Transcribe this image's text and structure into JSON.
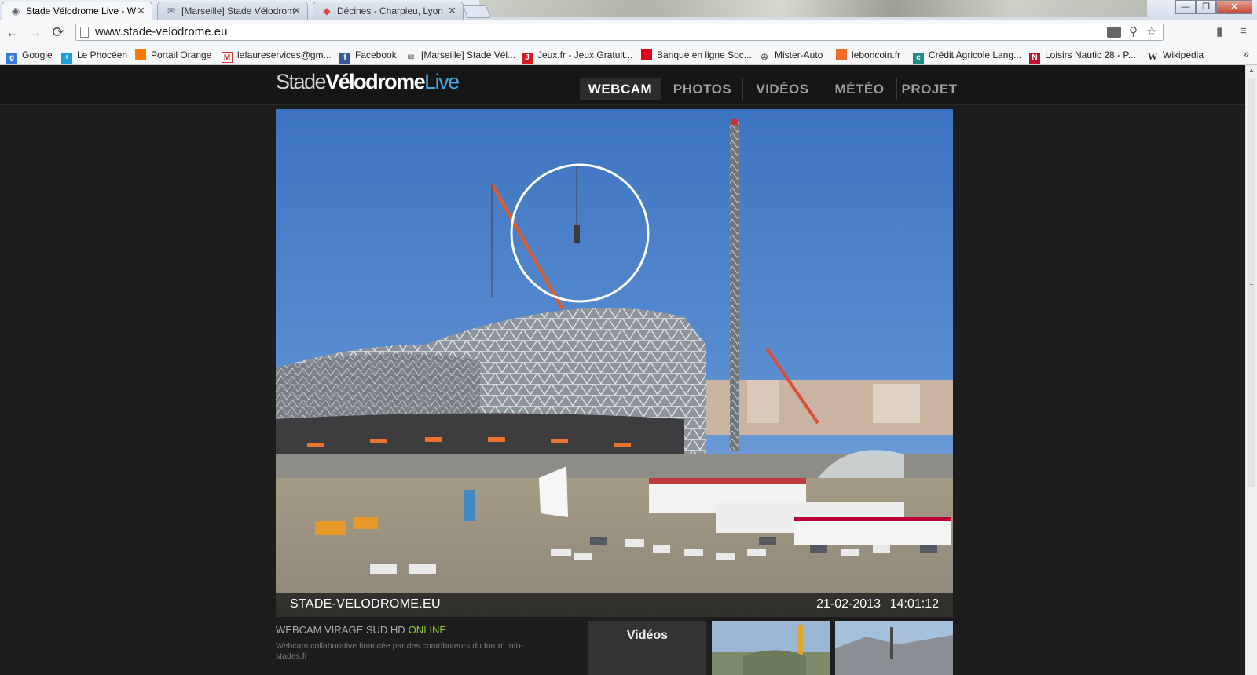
{
  "tabs": [
    {
      "title": "Stade Vélodrome Live - W",
      "icon": "webcam-icon",
      "active": true
    },
    {
      "title": "[Marseille] Stade Vélodrom",
      "icon": "forum-icon",
      "active": false
    },
    {
      "title": "Décines - Charpieu, Lyon",
      "icon": "maps-icon",
      "active": false
    }
  ],
  "toolbar": {
    "back": "←",
    "forward": "→",
    "reload": "⟳",
    "url": "www.stade-velodrome.eu"
  },
  "bookmarks": [
    {
      "label": "Google",
      "icon": "google-icon",
      "color": "#3b7be0"
    },
    {
      "label": "Le Phocéen",
      "icon": "phoceen-icon",
      "color": "#1d9fd8"
    },
    {
      "label": "Portail Orange",
      "icon": "orange-icon",
      "color": "#ff7900"
    },
    {
      "label": "lefaureservices@gm...",
      "icon": "gmail-icon",
      "color": "#d93025"
    },
    {
      "label": "Facebook",
      "icon": "facebook-icon",
      "color": "#3b5998"
    },
    {
      "label": "[Marseille] Stade Vél...",
      "icon": "forum-icon",
      "color": "#9aa"
    },
    {
      "label": "Jeux.fr - Jeux Gratuit...",
      "icon": "jeux-icon",
      "color": "#d71920"
    },
    {
      "label": "Banque en ligne Soc...",
      "icon": "bank-icon",
      "color": "#e2001a"
    },
    {
      "label": "Mister-Auto",
      "icon": "car-icon",
      "color": "#555"
    },
    {
      "label": "leboncoin.fr",
      "icon": "leboncoin-icon",
      "color": "#f56b2a"
    },
    {
      "label": "Crédit Agricole Lang...",
      "icon": "credit-agricole-icon",
      "color": "#1a8c83"
    },
    {
      "label": "Loisirs Nautic 28 - P...",
      "icon": "nautic-icon",
      "color": "#c8102e"
    },
    {
      "label": "Wikipedia",
      "icon": "wikipedia-icon",
      "color": "#333"
    }
  ],
  "site": {
    "logo_part1": "Stade",
    "logo_part2": "Vélodrome",
    "logo_part3": "Live",
    "nav": [
      "WEBCAM",
      "PHOTOS",
      "VIDÉOS",
      "MÉTÉO",
      "PROJET"
    ],
    "nav_active": "WEBCAM"
  },
  "webcam": {
    "brand": "STADE-VELODROME.EU",
    "date": "21-02-2013",
    "time": "14:01:12"
  },
  "info": {
    "title": "WEBCAM VIRAGE SUD HD",
    "status": "ONLINE",
    "description": "Webcam collaborative financée par des contributeurs du forum info-stades.fr"
  },
  "videos_label": "Vidéos",
  "colors": {
    "accent": "#3fa9e0",
    "online": "#8cc63f",
    "background": "#1d1d1d"
  }
}
